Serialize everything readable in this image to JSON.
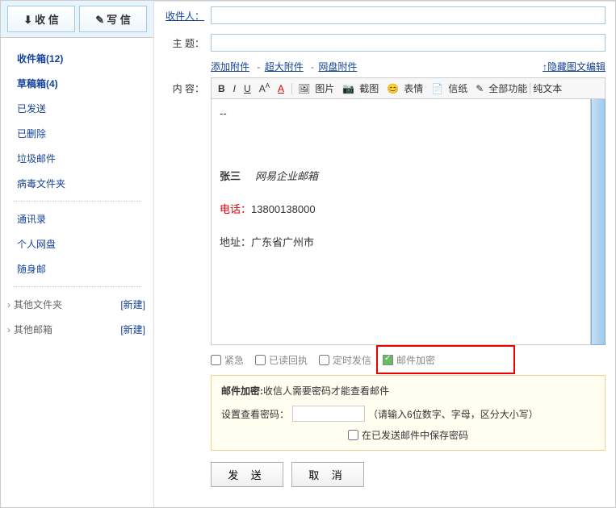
{
  "sidebar": {
    "receive": "收 信",
    "compose": "写 信",
    "items": [
      {
        "label": "收件箱(12)",
        "bold": true
      },
      {
        "label": "草稿箱(4)",
        "bold": true
      },
      {
        "label": "已发送"
      },
      {
        "label": "已删除"
      },
      {
        "label": "垃圾邮件"
      },
      {
        "label": "病毒文件夹"
      }
    ],
    "items2": [
      {
        "label": "通讯录"
      },
      {
        "label": "个人网盘"
      },
      {
        "label": "随身邮"
      }
    ],
    "expand": [
      {
        "label": "其他文件夹",
        "new": "[新建]"
      },
      {
        "label": "其他邮箱",
        "new": "[新建]"
      }
    ]
  },
  "compose": {
    "to_label": "收件人：",
    "subject_label": "主 题：",
    "content_label": "内 容：",
    "attach": {
      "add": "添加附件",
      "large": "超大附件",
      "netdisk": "网盘附件",
      "dash": " - "
    },
    "hide_imgedit": "↑隐藏图文编辑",
    "toolbar": {
      "pic": "图片",
      "shot": "截图",
      "emoji": "表情",
      "paper": "信纸",
      "full": "全部功能",
      "plain": "纯文本"
    },
    "body": {
      "divider": "--",
      "name": "张三",
      "name_sub": "网易企业邮箱",
      "tel_label": "电话：",
      "tel_num": "13800138000",
      "addr_label": "地址：",
      "addr_val": "广东省广州市"
    },
    "options": {
      "urgent": "紧急",
      "receipt": "已读回执",
      "timed": "定时发信",
      "encrypt": "邮件加密"
    },
    "encrypt_panel": {
      "title_bold": "邮件加密:",
      "title_rest": "收信人需要密码才能查看邮件",
      "pw_label": "设置查看密码：",
      "pw_hint": "（请输入6位数字、字母，区分大小写）",
      "save_pw": "在已发送邮件中保存密码"
    },
    "actions": {
      "send": "发 送",
      "cancel": "取 消"
    }
  }
}
